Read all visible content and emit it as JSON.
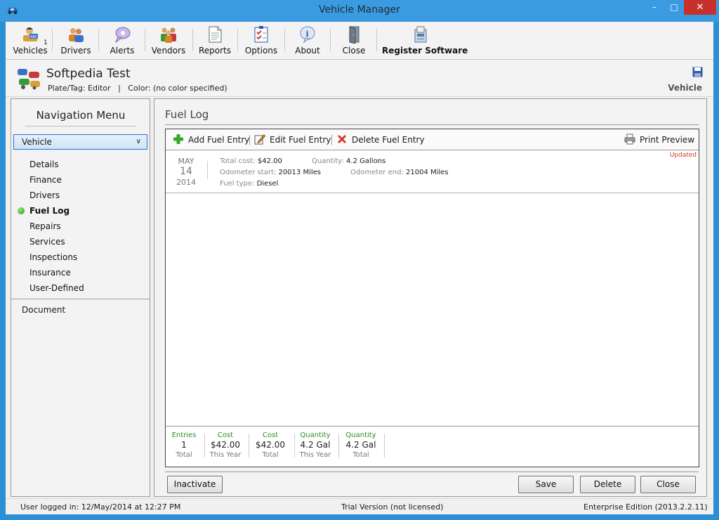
{
  "window": {
    "title": "Vehicle Manager",
    "minimize": "–",
    "maximize": "□",
    "close": "✕"
  },
  "toolbar": {
    "items": [
      {
        "label": "Vehicles",
        "icon": "vehicles-icon",
        "badge": "1"
      },
      {
        "label": "Drivers",
        "icon": "drivers-icon"
      },
      {
        "label": "Alerts",
        "icon": "alerts-icon"
      },
      {
        "label": "Vendors",
        "icon": "vendors-icon"
      },
      {
        "label": "Reports",
        "icon": "reports-icon"
      },
      {
        "label": "Options",
        "icon": "options-icon"
      },
      {
        "label": "About",
        "icon": "about-icon"
      },
      {
        "label": "Close",
        "icon": "close-door-icon"
      },
      {
        "label": "Register Software",
        "icon": "register-icon"
      }
    ]
  },
  "header": {
    "vehicle_name": "Softpedia Test",
    "subline": "Plate/Tag: Editor   |   Color: (no color specified)",
    "context_label": "Vehicle"
  },
  "nav": {
    "title": "Navigation Menu",
    "selected_group": "Vehicle",
    "items": [
      {
        "label": "Details"
      },
      {
        "label": "Finance"
      },
      {
        "label": "Drivers"
      },
      {
        "label": "Fuel Log",
        "active": true
      },
      {
        "label": "Repairs"
      },
      {
        "label": "Services"
      },
      {
        "label": "Inspections"
      },
      {
        "label": "Insurance"
      },
      {
        "label": "User-Defined"
      }
    ],
    "document": "Document"
  },
  "fuel_log": {
    "title": "Fuel Log",
    "actions": {
      "add": "Add Fuel Entry",
      "edit": "Edit Fuel Entry",
      "delete": "Delete Fuel Entry",
      "print": "Print Preview"
    },
    "entry": {
      "month": "MAY",
      "day": "14",
      "year": "2014",
      "updated": "Updated",
      "total_cost_label": "Total cost:",
      "total_cost": "$42.00",
      "quantity_label": "Quantity:",
      "quantity": "4.2 Gallons",
      "odo_start_label": "Odometer start:",
      "odo_start": "20013 Miles",
      "odo_end_label": "Odometer end:",
      "odo_end": "21004 Miles",
      "fuel_type_label": "Fuel type:",
      "fuel_type": "Diesel"
    },
    "summary": [
      {
        "header": "Entries",
        "value": "1",
        "sub": "Total"
      },
      {
        "header": "Cost",
        "value": "$42.00",
        "sub": "This Year"
      },
      {
        "header": "Cost",
        "value": "$42.00",
        "sub": "Total"
      },
      {
        "header": "Quantity",
        "value": "4.2 Gal",
        "sub": "This Year"
      },
      {
        "header": "Quantity",
        "value": "4.2 Gal",
        "sub": "Total"
      }
    ]
  },
  "buttons": {
    "inactivate": "Inactivate",
    "save": "Save",
    "delete": "Delete",
    "close": "Close"
  },
  "status": {
    "user": "User logged in:  12/May/2014 at 12:27 PM",
    "license": "Trial Version (not licensed)",
    "edition": "Enterprise Edition (2013.2.2.11)"
  },
  "colors": {
    "titlebar": "#3a9be0",
    "close_button": "#c7312b",
    "summary_header": "#2e8b2e",
    "updated": "#d23a2a",
    "active_dot": "#23a012"
  }
}
